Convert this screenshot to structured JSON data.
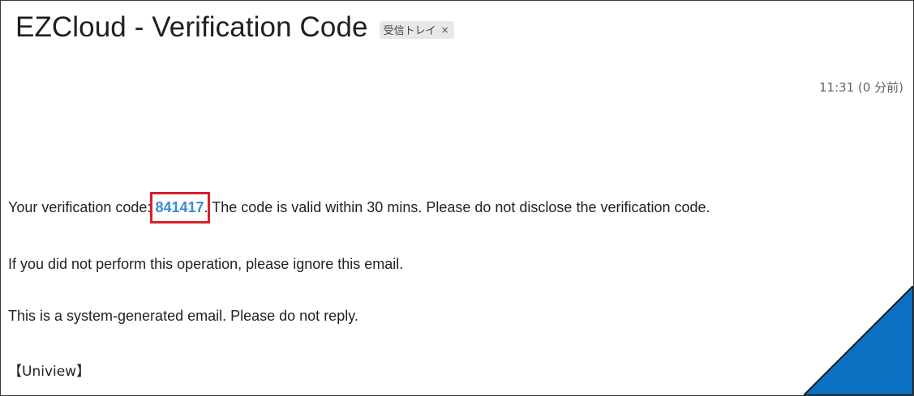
{
  "email": {
    "subject": "EZCloud - Verification Code",
    "label_chip": {
      "label": "受信トレイ",
      "close_glyph": "×"
    },
    "timestamp": "11:31 (0 分前)",
    "body": {
      "line1_prefix": "Your verification code: ",
      "verification_code": "841417",
      "line1_suffix": ". The code is valid within 30 mins. Please do not disclose the verification code.",
      "line2": "If you did not perform this operation, please ignore this email.",
      "line3": "This is a system-generated email. Please do not reply.",
      "signature": "【Uniview】"
    }
  },
  "colors": {
    "highlight_box": "#d8202a",
    "code_text": "#3a8ad6",
    "corner_fill": "#0b6fc2"
  }
}
